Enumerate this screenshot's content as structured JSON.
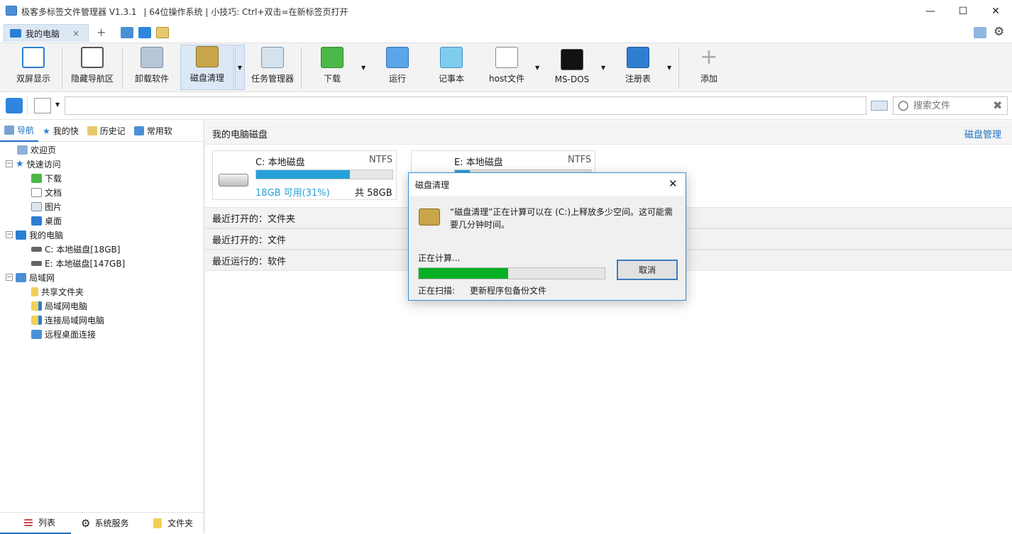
{
  "app": {
    "title": "极客多标签文件管理器 V1.3.1",
    "tip": "| 64位操作系统 | 小技巧: Ctrl+双击=在新标签页打开",
    "tab_label": "我的电脑",
    "tab_close": "×",
    "new_tab": "+"
  },
  "toolbar": {
    "items": [
      {
        "label": "双屏显示"
      },
      {
        "label": "隐藏导航区"
      },
      {
        "label": "卸载软件"
      },
      {
        "label": "磁盘清理"
      },
      {
        "label": "任务管理器"
      },
      {
        "label": "下载"
      },
      {
        "label": "运行"
      },
      {
        "label": "记事本"
      },
      {
        "label": "host文件"
      },
      {
        "label": "MS-DOS"
      },
      {
        "label": "注册表"
      },
      {
        "label": "添加"
      }
    ]
  },
  "address": {
    "value": "",
    "search_placeholder": "搜索文件"
  },
  "left": {
    "tabs": [
      "导航",
      "我的快",
      "历史记",
      "常用软"
    ],
    "tree": [
      {
        "label": "欢迎页"
      },
      {
        "label": "快速访问"
      },
      {
        "label": "下载"
      },
      {
        "label": "文档"
      },
      {
        "label": "图片"
      },
      {
        "label": "桌面"
      },
      {
        "label": "我的电脑"
      },
      {
        "label": "C: 本地磁盘[18GB]"
      },
      {
        "label": "E: 本地磁盘[147GB]"
      },
      {
        "label": "局域网"
      },
      {
        "label": "共享文件夹"
      },
      {
        "label": "局域网电脑"
      },
      {
        "label": "连接局域网电脑"
      },
      {
        "label": "远程桌面连接"
      }
    ],
    "bottom": [
      "列表",
      "系统服务",
      "文件夹"
    ]
  },
  "main": {
    "header": "我的电脑磁盘",
    "manage_link": "磁盘管理",
    "disks": [
      {
        "name": "C: 本地磁盘",
        "fs": "NTFS",
        "free_text": "18GB 可用(31%)",
        "total_text": "共 58GB",
        "used_fraction": 0.69
      },
      {
        "name": "E: 本地磁盘",
        "fs": "NTFS",
        "used_fraction": 0.11
      }
    ],
    "sections": [
      "最近打开的：文件夹",
      "最近打开的：文件",
      "最近运行的：软件"
    ]
  },
  "dialog": {
    "title": "磁盘清理",
    "message": "“磁盘清理”正在计算可以在 (C:)上释放多少空间。这可能需要几分钟时间。",
    "status": "正在计算...",
    "progress_fraction": 0.48,
    "cancel": "取消",
    "scan_label": "正在扫描:",
    "scan_item": "更新程序包备份文件"
  },
  "colors": {
    "accent": "#26a0da",
    "progress": "#06b025",
    "link": "#1e6fbf"
  }
}
